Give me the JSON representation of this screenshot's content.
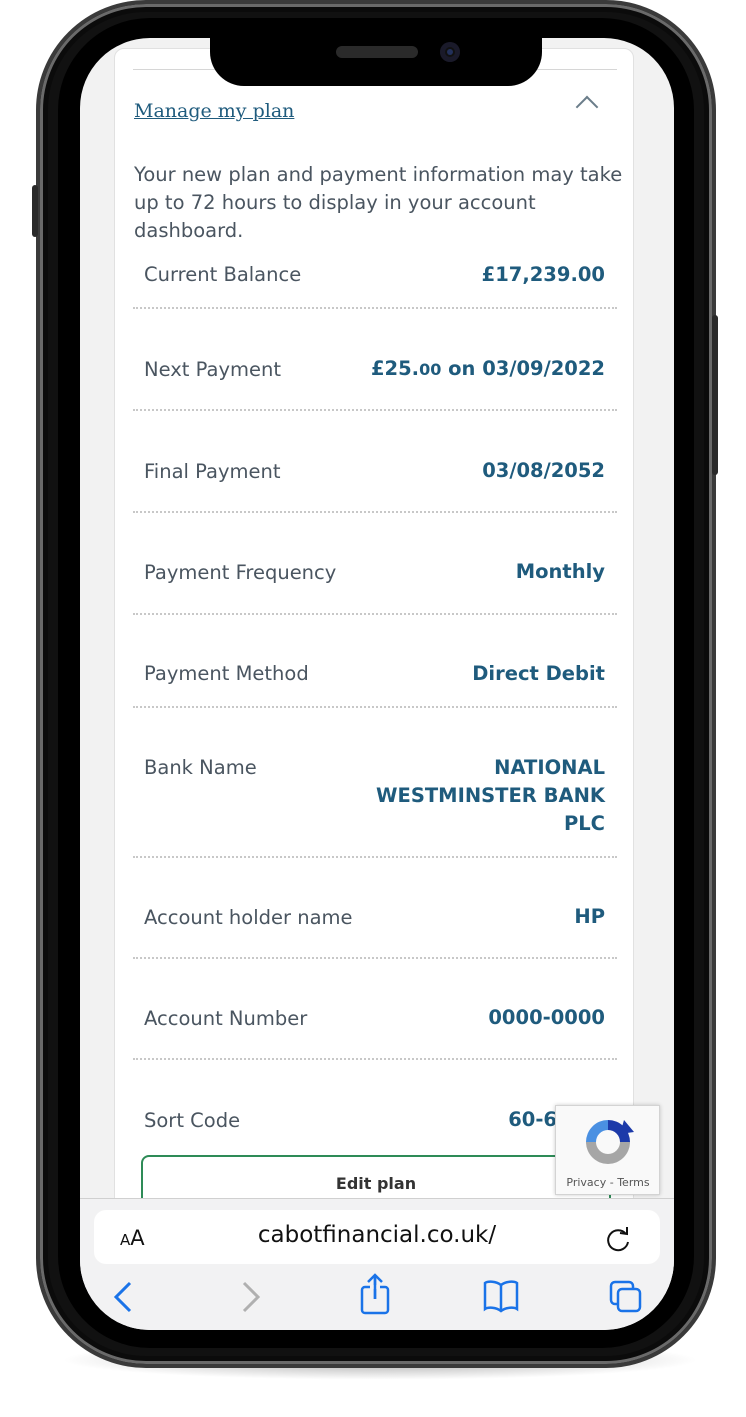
{
  "plan": {
    "section_link": "Manage my plan",
    "info": "Your new plan and payment information may take up to 72 hours to display in your account dashboard.",
    "rows": [
      {
        "label": "Current Balance",
        "value": "£17,239.00"
      },
      {
        "label": "Next Payment",
        "value_amount": "£25.",
        "value_pence": "00",
        "value_rest": " on 03/09/2022"
      },
      {
        "label": "Final Payment",
        "value": "03/08/2052"
      },
      {
        "label": "Payment Frequency",
        "value": "Monthly"
      },
      {
        "label": "Payment Method",
        "value": "Direct Debit"
      },
      {
        "label": "Bank Name",
        "value_line1": "NATIONAL",
        "value_line2": "WESTMINSTER BANK",
        "value_line3": "PLC"
      },
      {
        "label": "Account holder name",
        "value": "HP"
      },
      {
        "label": "Account Number",
        "value": "0000-0000"
      },
      {
        "label": "Sort Code",
        "value": "60-6"
      }
    ],
    "edit_button": "Edit plan"
  },
  "recaptcha": {
    "text": "Privacy - Terms"
  },
  "browser": {
    "aa_small": "A",
    "aa_big": "A",
    "url": "cabotfinancial.co.uk/",
    "icons": [
      "back-icon",
      "forward-icon",
      "share-icon",
      "bookmarks-icon",
      "tabs-icon",
      "reload-icon"
    ]
  },
  "colors": {
    "value_text": "#1f5b7d",
    "label_text": "#4a5560",
    "button_border": "#2e8b57"
  }
}
